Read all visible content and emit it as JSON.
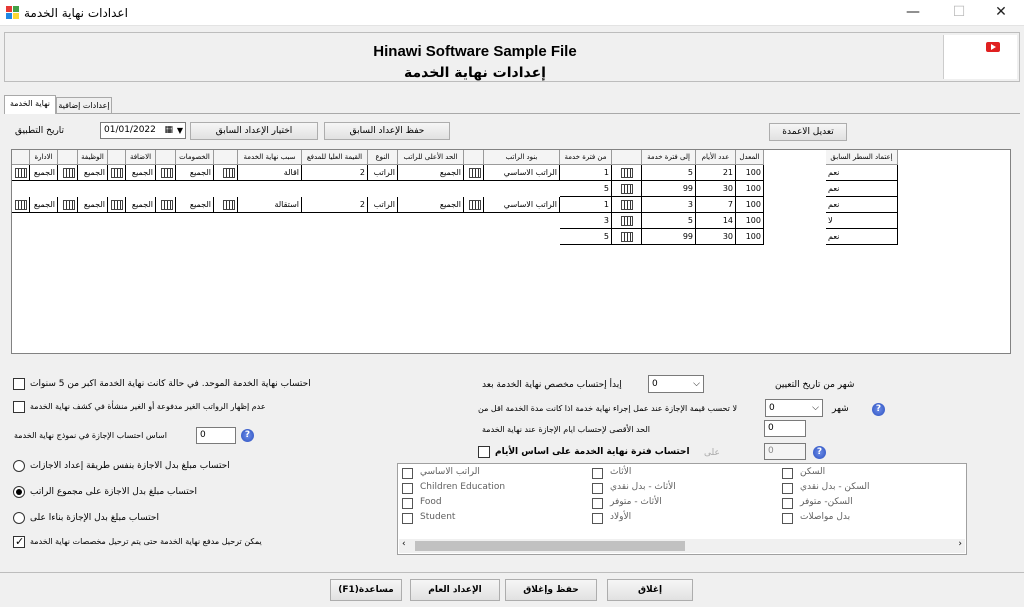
{
  "window": {
    "title": "اعدادات نهاية الخدمة",
    "minimize": "—",
    "maximize": "☐",
    "close": "✕"
  },
  "header": {
    "company": "Hinawi Software Sample File",
    "subtitle": "إعدادات نهاية الخدمة"
  },
  "tabs": [
    {
      "label": "نهاية الخدمة",
      "active": true
    },
    {
      "label": "إعدادات إضافية",
      "active": false
    }
  ],
  "toolbar": {
    "date_label": "تاريخ التطبيق",
    "date_value": "01/01/2022",
    "choose_previous": "اختيار الإعداد السابق",
    "save_previous": "حفظ الإعداد السابق",
    "edit_column": "تعديل الاعمدة"
  },
  "grid": {
    "right_headers": [
      "إعتماد السطر السابق",
      "المعدل",
      "عدد الأيام",
      "إلى فترة خدمة",
      "",
      "من فترة خدمة"
    ],
    "left_headers": [
      "بنود الراتب",
      "",
      "الحد الأعلى للراتب",
      "النوع",
      "القيمة العليا للمدفع",
      "سبب نهاية الخدمة",
      "",
      "الخصومات",
      "",
      "الاضافة",
      "",
      "الوظيفة",
      "",
      "الادارة",
      ""
    ],
    "right_rows": [
      {
        "approve": "نعم",
        "rate": "100",
        "days": "21",
        "to": "5",
        "from": "1"
      },
      {
        "approve": "نعم",
        "rate": "100",
        "days": "30",
        "to": "99",
        "from": "5"
      },
      {
        "approve": "نعم",
        "rate": "100",
        "days": "7",
        "to": "3",
        "from": "1"
      },
      {
        "approve": "لا",
        "rate": "100",
        "days": "14",
        "to": "5",
        "from": "3"
      },
      {
        "approve": "نعم",
        "rate": "100",
        "days": "30",
        "to": "99",
        "from": "5"
      }
    ],
    "left_rows": [
      {
        "items": "الراتب الاساسي",
        "max_salary": "الجميع",
        "type": "الراتب",
        "max_value": "2",
        "reason": "اقالة",
        "deductions": "الجميع",
        "additions": "الجميع",
        "job": "الجميع",
        "dept": "الجميع"
      },
      {
        "items": "الراتب الاساسي",
        "max_salary": "الجميع",
        "type": "الراتب",
        "max_value": "2",
        "reason": "استقالة",
        "deductions": "الجميع",
        "additions": "الجميع",
        "job": "الجميع",
        "dept": "الجميع"
      }
    ]
  },
  "left_options": {
    "unified_calc": "احتساب نهاية الخدمة الموحد. في حالة كانت  نهاية الخدمة اكبر من 5 سنوات",
    "hide_unpaid": "عدم إظهار الرواتب الغير مدفوعة أو الغير منشأة في كشف نهاية الخدمة",
    "leave_basis_label": "اساس احتساب الإجازة في نموذج نهاية الخدمة",
    "leave_basis_value": "0",
    "radio_same_method": "احتساب مبلغ بدل الاجازة بنفس طريقة إعداد الاجازات",
    "radio_total_salary": "احتساب مبلغ بدل الاجازة على مجموع الراتب",
    "radio_based_on": "احتساب مبلغ بدل الإجازة بناءا على",
    "carry_over": "يمكن ترحيل مدفع نهاية الخدمة حتى يتم ترحيل مخصصات نهاية الخدمة"
  },
  "right_options": {
    "start_provision": "إبدأ إحتساب مخصص نهاية الخدمة بعد",
    "start_value": "0",
    "month_from_hire": "شهر من تاريخ التعيين",
    "no_leave_value": "لا تحسب قيمة الإجازة عند عمل إجراء نهاية خدمة اذا كانت مدة الخدمة اقل من",
    "no_leave_combo": "0",
    "month": "شهر",
    "max_leave_days": "الحد الأقصى لإحتساب ايام الإجازة عند نهاية الخدمة",
    "max_leave_value": "0",
    "calc_days_basis": "احتساب فترة نهاية الخدمة على اساس الأيام",
    "on_label": "على",
    "on_value": "0"
  },
  "salary_items": [
    [
      "الراتب الاساسي",
      "الأثاث",
      "السكن"
    ],
    [
      "Children Education",
      "الأثاث - بدل نقدي",
      "السكن - بدل نقدي"
    ],
    [
      "Food",
      "الأثاث - متوفر",
      "السكن- متوفر"
    ],
    [
      "Student",
      "الأولاد",
      "بدل مواصلات"
    ]
  ],
  "footer": {
    "help": "(F1)مساعدة",
    "general_settings": "الإعداد العام",
    "save_close": "حفظ وإغلاق",
    "close": "إغلاق"
  },
  "colors": {
    "window_bg": "#f0f0f0",
    "help_icon": "#2a4fc0",
    "youtube": "#e02020"
  },
  "icons": {
    "app": "app-icon",
    "grid_button": "grid-selector-icon",
    "help": "question-icon",
    "calendar": "calendar-icon",
    "youtube": "youtube-icon"
  }
}
